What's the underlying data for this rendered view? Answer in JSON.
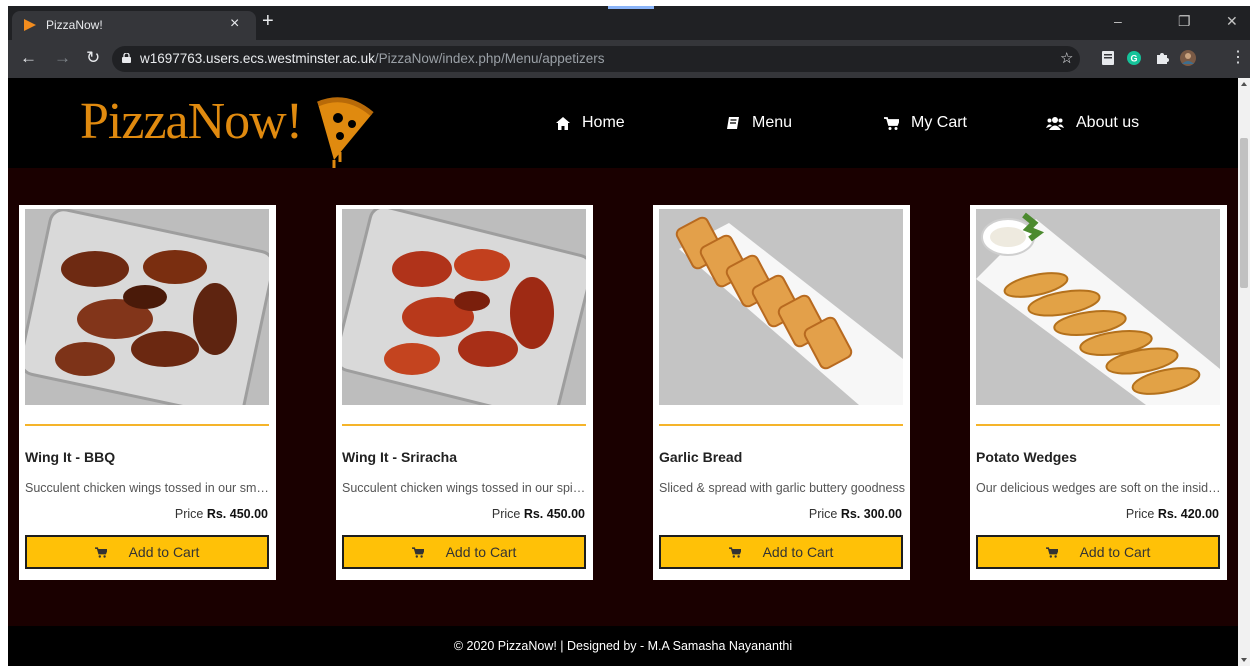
{
  "browser": {
    "tab_title": "PizzaNow!",
    "tab_close": "×",
    "new_tab": "+",
    "url_host": "w1697763.users.ecs.westminster.ac.uk",
    "url_path": "/PizzaNow/index.php/Menu/appetizers",
    "window_controls": [
      "–",
      "❐",
      "✕"
    ],
    "nav_icons": [
      "arrow-left-icon",
      "arrow-right-icon",
      "reload-icon"
    ]
  },
  "header": {
    "logo_text": "PizzaNow!",
    "nav": [
      {
        "label": "Home",
        "icon": "home-icon"
      },
      {
        "label": "Menu",
        "icon": "book-icon"
      },
      {
        "label": "My Cart",
        "icon": "cart-icon"
      },
      {
        "label": "About us",
        "icon": "users-icon"
      }
    ]
  },
  "products": [
    {
      "name": "Wing It - BBQ",
      "description": "Succulent chicken wings tossed in our smoky BBQ sauce",
      "price_label": "Price",
      "price": "Rs. 450.00",
      "button": "Add to Cart"
    },
    {
      "name": "Wing It - Sriracha",
      "description": "Succulent chicken wings tossed in our spicy sriracha sauce",
      "price_label": "Price",
      "price": "Rs. 450.00",
      "button": "Add to Cart"
    },
    {
      "name": "Garlic Bread",
      "description": "Sliced & spread with garlic buttery goodness",
      "price_label": "Price",
      "price": "Rs. 300.00",
      "button": "Add to Cart"
    },
    {
      "name": "Potato Wedges",
      "description": "Our delicious wedges are soft on the inside and crispy outside",
      "price_label": "Price",
      "price": "Rs. 420.00",
      "button": "Add to Cart"
    }
  ],
  "footer": {
    "text": "© 2020 PizzaNow! | Designed by - M.A Samasha Nayananthi"
  },
  "colors": {
    "page_bg": "#1a0000",
    "header_bg": "#000000",
    "accent": "#ffc107",
    "logo": "#e08a0f",
    "rule": "#f5b42a"
  }
}
